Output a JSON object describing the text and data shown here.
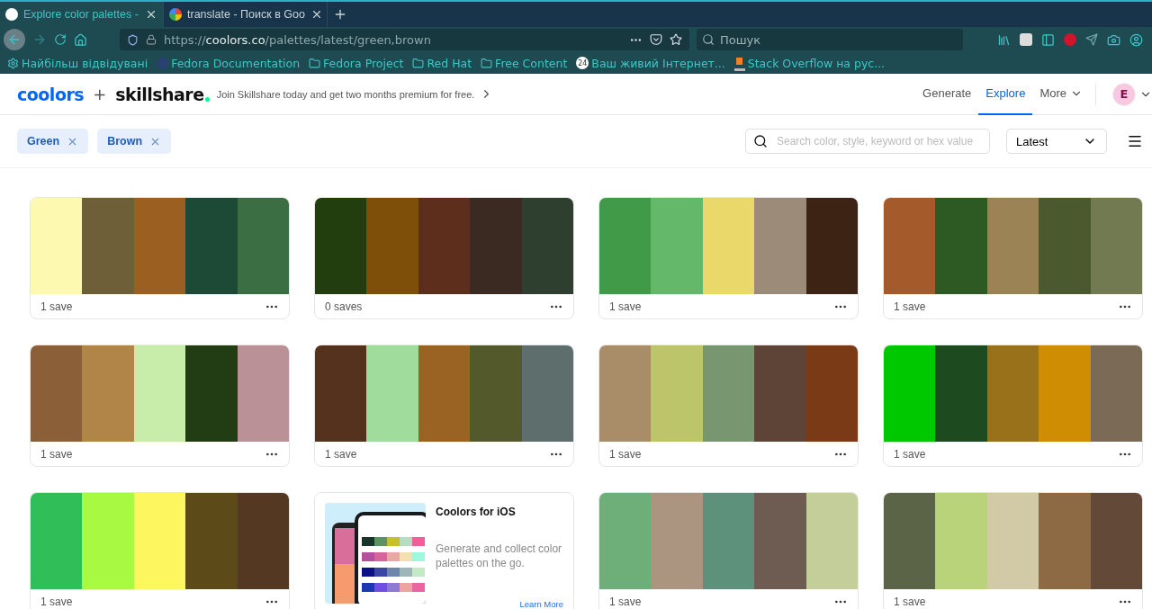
{
  "browser": {
    "tabs": [
      {
        "title": "Explore color palettes -",
        "selected": true
      },
      {
        "title": "translate - Поиск в Goo",
        "selected": false
      }
    ],
    "address": "https://**coolors.co**/palettes/latest/green,brown",
    "search": {
      "placeholder": "Пошук"
    },
    "bookmarks": [
      {
        "kind": "gear",
        "label": "Найбільш відвідувані"
      },
      {
        "kind": "fedora",
        "label": "Fedora Documentation"
      },
      {
        "kind": "folder",
        "label": "Fedora Project"
      },
      {
        "kind": "folder",
        "label": "Red Hat"
      },
      {
        "kind": "folder",
        "label": "Free Content"
      },
      {
        "kind": "badge",
        "badge": "24",
        "label": "Ваш живий Інтернет..."
      },
      {
        "kind": "stack",
        "label": "Stack Overflow на рус..."
      }
    ]
  },
  "header": {
    "logo": "coolors",
    "plus": "+",
    "partner": "skillshare",
    "promo": "Join Skillshare today and get two months premium for free.",
    "nav": [
      {
        "label": "Generate",
        "selected": false
      },
      {
        "label": "Explore",
        "selected": true
      },
      {
        "label": "More",
        "selected": false
      }
    ],
    "avatar": "E"
  },
  "filters": {
    "chips": [
      "Green",
      "Brown"
    ],
    "search": {
      "placeholder": "Search color, style, keyword or hex value"
    },
    "sort": "Latest"
  },
  "cards": [
    {
      "kind": "palette",
      "swatches": [
        {
          "color": "#fdf9b0"
        },
        {
          "color": "#6e5f38"
        },
        {
          "color": "#9b5f21"
        },
        {
          "color": "#1d4a37"
        },
        {
          "color": "#3b6e43"
        }
      ],
      "saves": "1 save"
    },
    {
      "kind": "palette",
      "swatches": [
        {
          "color": "#223d0e"
        },
        {
          "color": "#7e4f08"
        },
        {
          "color": "#5e2e1c"
        },
        {
          "color": "#3b2a22"
        },
        {
          "color": "#2f3f2f"
        }
      ],
      "saves": "0 saves"
    },
    {
      "kind": "palette",
      "swatches": [
        {
          "color": "#419a47"
        },
        {
          "color": "#63b86a"
        },
        {
          "color": "#ebd86b"
        },
        {
          "color": "#9d8b79"
        },
        {
          "color": "#3d2314"
        }
      ],
      "saves": "1 save"
    },
    {
      "kind": "palette",
      "swatches": [
        {
          "color": "#a45a2a"
        },
        {
          "color": "#2c5a22"
        },
        {
          "color": "#9b8356"
        },
        {
          "color": "#4b5a2e"
        },
        {
          "color": "#727a51"
        }
      ],
      "saves": "1 save"
    },
    {
      "kind": "palette",
      "swatches": [
        {
          "color": "#8b6038"
        },
        {
          "color": "#b08547"
        },
        {
          "color": "#c8edaa"
        },
        {
          "color": "#223d13"
        },
        {
          "color": "#b99196"
        }
      ],
      "saves": "1 save"
    },
    {
      "kind": "palette",
      "swatches": [
        {
          "color": "#55321e"
        },
        {
          "color": "#a0dc9c"
        },
        {
          "color": "#9a6324"
        },
        {
          "color": "#53592b"
        },
        {
          "color": "#5d6e6d"
        }
      ],
      "saves": "1 save"
    },
    {
      "kind": "palette",
      "swatches": [
        {
          "color": "#a98d68"
        },
        {
          "color": "#bcc56a"
        },
        {
          "color": "#789670"
        },
        {
          "color": "#5e4337"
        },
        {
          "color": "#7a3a16"
        }
      ],
      "saves": "1 save"
    },
    {
      "kind": "palette",
      "swatches": [
        {
          "color": "#00c800"
        },
        {
          "color": "#1d4a1f"
        },
        {
          "color": "#9a711b"
        },
        {
          "color": "#cf8d04"
        },
        {
          "color": "#7b6b56"
        }
      ],
      "saves": "1 save"
    },
    {
      "kind": "palette",
      "swatches": [
        {
          "color": "#2fbe57"
        },
        {
          "color": "#a7f941"
        },
        {
          "color": "#fdf65f"
        },
        {
          "color": "#5c4a18"
        },
        {
          "color": "#553821"
        }
      ],
      "saves": "1 save"
    },
    {
      "kind": "promo",
      "title": "Coolors for iOS",
      "text": "Generate and collect color palettes on the go.",
      "link": "Learn More"
    },
    {
      "kind": "palette",
      "swatches": [
        {
          "color": "#6eae78"
        },
        {
          "color": "#ab9580"
        },
        {
          "color": "#5d917b"
        },
        {
          "color": "#6e5c52"
        },
        {
          "color": "#c4ce9a"
        }
      ],
      "saves": "1 save"
    },
    {
      "kind": "palette",
      "swatches": [
        {
          "color": "#5c6448"
        },
        {
          "color": "#b9d37b"
        },
        {
          "color": "#d2caa7"
        },
        {
          "color": "#8e6a44"
        },
        {
          "color": "#634a38"
        }
      ],
      "saves": "1 save"
    }
  ]
}
